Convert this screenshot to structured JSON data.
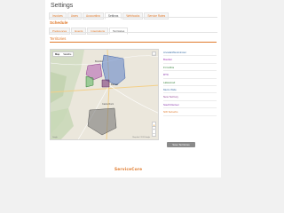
{
  "page": {
    "title": "Settings"
  },
  "top_tabs": [
    {
      "label": "Invoices",
      "active": false
    },
    {
      "label": "Users",
      "active": false
    },
    {
      "label": "Accounting",
      "active": false
    },
    {
      "label": "Settings",
      "active": true
    },
    {
      "label": "Webhooks",
      "active": false
    },
    {
      "label": "Service Rates",
      "active": false
    }
  ],
  "section": {
    "title": "Schedule"
  },
  "sub_tabs": [
    {
      "label": "Preferences",
      "active": false
    },
    {
      "label": "Events",
      "active": false
    },
    {
      "label": "Integrations",
      "active": false
    },
    {
      "label": "Territories",
      "active": true
    }
  ],
  "territories": {
    "title": "Territories",
    "items": [
      {
        "label": "Arvada/Westminster",
        "color": "#3a6ea5"
      },
      {
        "label": "Boulder",
        "color": "#9c27b0"
      },
      {
        "label": "Ft Collins",
        "color": "#2e7d32"
      },
      {
        "label": "DTC",
        "color": "#7b1fa2"
      },
      {
        "label": "Lakewood",
        "color": "#2e7d32"
      },
      {
        "label": "Metro Wide",
        "color": "#3a6ea5"
      },
      {
        "label": "New Territory",
        "color": "#8e3a8e"
      },
      {
        "label": "South Denver",
        "color": "#7b1fa2"
      },
      {
        "label": "NW Suburbs",
        "color": "#e07a2c"
      }
    ],
    "save_label": "Save Territories"
  },
  "map": {
    "type_options": [
      "Map",
      "Satellite"
    ],
    "active_type": "Map",
    "attribution": "Google",
    "attribution_right": "Map data ©2018 Google",
    "zoom_in": "+",
    "zoom_out": "−"
  },
  "footer": {
    "logo_text": "ServiceCore"
  }
}
